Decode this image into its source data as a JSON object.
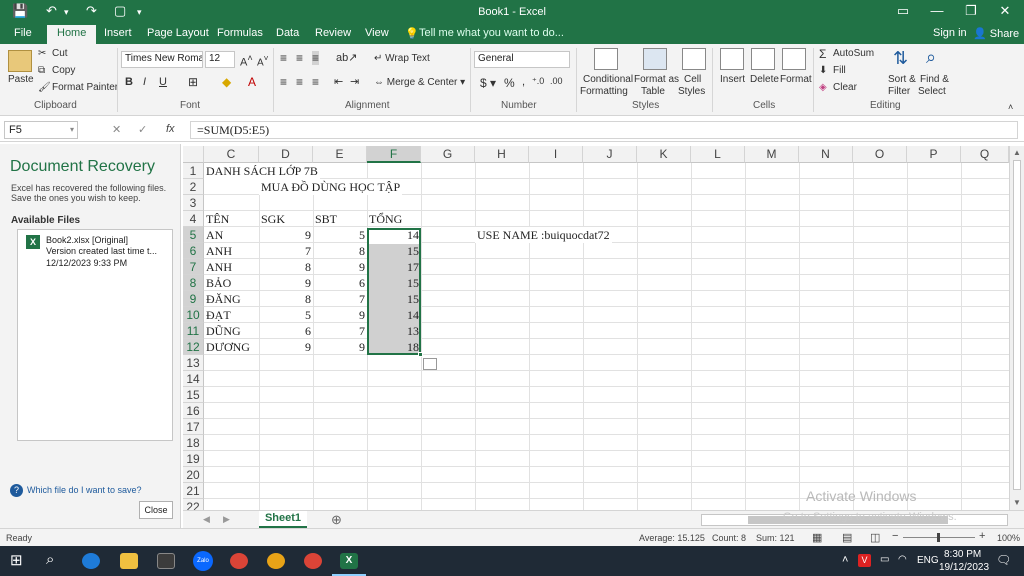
{
  "window": {
    "title": "Book1 - Excel"
  },
  "ribbon_tabs": [
    "File",
    "Home",
    "Insert",
    "Page Layout",
    "Formulas",
    "Data",
    "Review",
    "View"
  ],
  "tell_me": "Tell me what you want to do...",
  "sign_in": "Sign in",
  "share": "Share",
  "clipboard": {
    "paste": "Paste",
    "cut": "Cut",
    "copy": "Copy",
    "format_painter": "Format Painter",
    "label": "Clipboard"
  },
  "font": {
    "name": "Times New Roma",
    "size": "12",
    "label": "Font"
  },
  "alignment": {
    "wrap": "Wrap Text",
    "merge": "Merge & Center",
    "label": "Alignment"
  },
  "number": {
    "format": "General",
    "label": "Number"
  },
  "styles": {
    "cond1": "Conditional",
    "cond2": "Formatting",
    "fat1": "Format as",
    "fat2": "Table",
    "cs1": "Cell",
    "cs2": "Styles",
    "label": "Styles"
  },
  "cells": {
    "insert": "Insert",
    "delete": "Delete",
    "format": "Format",
    "label": "Cells"
  },
  "editing": {
    "autosum": "AutoSum",
    "fill": "Fill",
    "clear": "Clear",
    "sort1": "Sort &",
    "sort2": "Filter",
    "find1": "Find &",
    "find2": "Select",
    "label": "Editing"
  },
  "formula_bar": {
    "name_box": "F5",
    "formula": "=SUM(D5:E5)"
  },
  "recovery": {
    "title": "Document Recovery",
    "message": "Excel has recovered the following files. Save the ones you wish to keep.",
    "available": "Available Files",
    "file_name": "Book2.xlsx  [Original]",
    "file_desc": "Version created last time t...",
    "file_date": "12/12/2023 9:33 PM",
    "which": "Which file do I want to save?",
    "close": "Close"
  },
  "columns": [
    "C",
    "D",
    "E",
    "F",
    "G",
    "H",
    "I",
    "J",
    "K",
    "L",
    "M",
    "N",
    "O",
    "P",
    "Q"
  ],
  "rows": [
    "1",
    "2",
    "3",
    "4",
    "5",
    "6",
    "7",
    "8",
    "9",
    "10",
    "11",
    "12",
    "13",
    "14",
    "15",
    "16",
    "17",
    "18",
    "19",
    "20",
    "21",
    "22"
  ],
  "sheet": {
    "title1": "DANH SÁCH LỚP 7B",
    "title2": "MUA ĐỒ DÙNG HỌC TẬP",
    "headers": [
      "TÊN",
      "SGK",
      "SBT",
      "TỔNG"
    ],
    "data": [
      [
        "AN",
        "9",
        "5",
        "14"
      ],
      [
        "ANH",
        "7",
        "8",
        "15"
      ],
      [
        "ANH",
        "8",
        "9",
        "17"
      ],
      [
        "BẢO",
        "9",
        "6",
        "15"
      ],
      [
        "ĐĂNG",
        "8",
        "7",
        "15"
      ],
      [
        "ĐẠT",
        "5",
        "9",
        "14"
      ],
      [
        "DŨNG",
        "6",
        "7",
        "13"
      ],
      [
        "DƯƠNG",
        "9",
        "9",
        "18"
      ]
    ],
    "note": "USE NAME :buiquocdat72"
  },
  "sheet_tab": "Sheet1",
  "status": {
    "ready": "Ready",
    "average": "Average: 15.125",
    "count": "Count: 8",
    "sum": "Sum: 121",
    "zoom": "100%"
  },
  "watermark": {
    "line1": "Activate Windows",
    "line2": "Go to Settings to activate Windows."
  },
  "taskbar": {
    "lang": "ENG",
    "time": "8:30 PM",
    "date": "19/12/2023",
    "zalo": "Zalo"
  }
}
